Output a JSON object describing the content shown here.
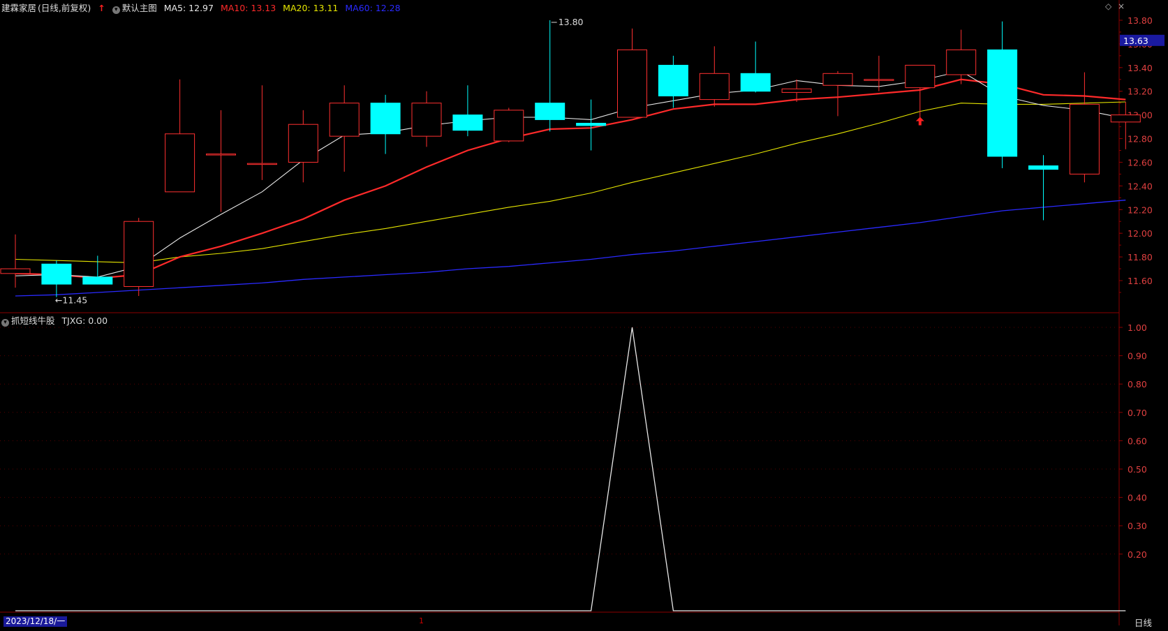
{
  "header": {
    "stock_name": "建霖家居",
    "period_info": "(日线,前复权)",
    "template_name": "默认主图",
    "ma5": "MA5: 12.97",
    "ma10": "MA10: 13.13",
    "ma20": "MA20: 13.11",
    "ma60": "MA60: 12.28",
    "colors": {
      "ma5": "#e8e8e8",
      "ma10": "#ff2a2a",
      "ma20": "#e6e600",
      "ma60": "#2a2aff"
    }
  },
  "indicator_header": {
    "name": "抓短线牛股",
    "value_label": "TJXG: 0.00"
  },
  "footer": {
    "date": "2023/12/18/一",
    "cursor_mark": "1",
    "period": "日线"
  },
  "chart_data": [
    {
      "type": "candlestick",
      "title": "建霖家居 (日线,前复权)",
      "ylim": [
        11.45,
        13.87
      ],
      "y_ticks": [
        "13.80",
        "13.60",
        "13.40",
        "13.20",
        "13.00",
        "12.80",
        "12.60",
        "12.40",
        "12.20",
        "12.00",
        "11.80",
        "11.60"
      ],
      "current_price_label": "13.63",
      "annotations": {
        "high": "13.80",
        "low": "11.45"
      },
      "candles": [
        {
          "o": 11.66,
          "c": 11.7,
          "h": 11.99,
          "l": 11.54
        },
        {
          "o": 11.74,
          "c": 11.57,
          "h": 11.77,
          "l": 11.46
        },
        {
          "o": 11.63,
          "c": 11.57,
          "h": 11.81,
          "l": 11.57
        },
        {
          "o": 11.55,
          "c": 12.1,
          "h": 12.13,
          "l": 11.47
        },
        {
          "o": 12.35,
          "c": 12.84,
          "h": 13.3,
          "l": 12.35
        },
        {
          "o": 12.67,
          "c": 12.67,
          "h": 13.04,
          "l": 12.18
        },
        {
          "o": 12.59,
          "c": 12.59,
          "h": 13.25,
          "l": 12.45
        },
        {
          "o": 12.6,
          "c": 12.92,
          "h": 13.04,
          "l": 12.43
        },
        {
          "o": 12.82,
          "c": 13.1,
          "h": 13.25,
          "l": 12.52
        },
        {
          "o": 13.1,
          "c": 12.84,
          "h": 13.17,
          "l": 12.67
        },
        {
          "o": 12.82,
          "c": 13.1,
          "h": 13.2,
          "l": 12.73
        },
        {
          "o": 13.0,
          "c": 12.87,
          "h": 13.25,
          "l": 12.82
        },
        {
          "o": 12.78,
          "c": 13.04,
          "h": 13.06,
          "l": 12.77
        },
        {
          "o": 13.1,
          "c": 12.96,
          "h": 13.8,
          "l": 12.86
        },
        {
          "o": 12.93,
          "c": 12.91,
          "h": 13.13,
          "l": 12.7
        },
        {
          "o": 12.98,
          "c": 13.55,
          "h": 13.73,
          "l": 12.98
        },
        {
          "o": 13.42,
          "c": 13.16,
          "h": 13.5,
          "l": 13.06
        },
        {
          "o": 13.13,
          "c": 13.35,
          "h": 13.58,
          "l": 13.07
        },
        {
          "o": 13.35,
          "c": 13.2,
          "h": 13.62,
          "l": 13.19
        },
        {
          "o": 13.19,
          "c": 13.22,
          "h": 13.3,
          "l": 13.11
        },
        {
          "o": 13.25,
          "c": 13.35,
          "h": 13.37,
          "l": 12.99
        },
        {
          "o": 13.3,
          "c": 13.3,
          "h": 13.5,
          "l": 13.2
        },
        {
          "o": 13.23,
          "c": 13.42,
          "h": 13.42,
          "l": 12.95
        },
        {
          "o": 13.34,
          "c": 13.55,
          "h": 13.72,
          "l": 13.26
        },
        {
          "o": 13.55,
          "c": 12.65,
          "h": 13.79,
          "l": 12.55
        },
        {
          "o": 12.57,
          "c": 12.54,
          "h": 12.66,
          "l": 12.11
        },
        {
          "o": 12.5,
          "c": 13.09,
          "h": 13.36,
          "l": 12.43
        },
        {
          "o": 12.94,
          "c": 13.0,
          "h": 13.11,
          "l": 12.71
        }
      ],
      "ma5": [
        11.64,
        11.65,
        11.63,
        11.72,
        11.96,
        12.16,
        12.35,
        12.62,
        12.83,
        12.85,
        12.91,
        12.95,
        12.98,
        12.98,
        12.96,
        13.06,
        13.12,
        13.18,
        13.21,
        13.29,
        13.25,
        13.24,
        13.29,
        13.37,
        13.16,
        13.08,
        13.04,
        12.97
      ],
      "ma10": [
        11.66,
        11.65,
        11.62,
        11.65,
        11.8,
        11.89,
        12.0,
        12.12,
        12.28,
        12.4,
        12.56,
        12.7,
        12.8,
        12.88,
        12.89,
        12.96,
        13.05,
        13.09,
        13.09,
        13.13,
        13.15,
        13.18,
        13.21,
        13.3,
        13.26,
        13.17,
        13.16,
        13.13
      ],
      "ma20": [
        11.78,
        11.77,
        11.76,
        11.75,
        11.8,
        11.83,
        11.87,
        11.93,
        11.99,
        12.04,
        12.1,
        12.16,
        12.22,
        12.27,
        12.34,
        12.43,
        12.51,
        12.59,
        12.67,
        12.76,
        12.84,
        12.93,
        13.03,
        13.1,
        13.09,
        13.09,
        13.1,
        13.11
      ],
      "ma60": [
        11.47,
        11.48,
        11.5,
        11.52,
        11.54,
        11.56,
        11.58,
        11.61,
        11.63,
        11.65,
        11.67,
        11.7,
        11.72,
        11.75,
        11.78,
        11.82,
        11.85,
        11.89,
        11.93,
        11.97,
        12.01,
        12.05,
        12.09,
        12.14,
        12.19,
        12.22,
        12.25,
        12.28
      ],
      "signal_arrow_index": 22
    },
    {
      "type": "line",
      "title": "抓短线牛股",
      "series": [
        {
          "name": "TJXG",
          "values": [
            0,
            0,
            0,
            0,
            0,
            0,
            0,
            0,
            0,
            0,
            0,
            0,
            0,
            0,
            0,
            1,
            0,
            0,
            0,
            0,
            0,
            0,
            0,
            0,
            0,
            0,
            0,
            0
          ]
        }
      ],
      "ylim": [
        0,
        1.0
      ],
      "y_ticks": [
        "1.00",
        "0.90",
        "0.80",
        "0.70",
        "0.60",
        "0.50",
        "0.40",
        "0.30",
        "0.20"
      ]
    }
  ]
}
